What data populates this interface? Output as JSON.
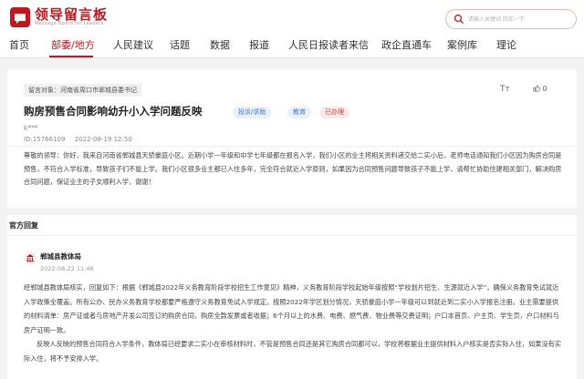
{
  "header": {
    "logo_title": "领导留言板",
    "logo_subtitle": "Message Board for Leaders",
    "search_placeholder": "请输入关键词 回车一下"
  },
  "nav": {
    "items": [
      "首页",
      "部委/地方",
      "人民建议",
      "话题",
      "数据",
      "报道",
      "人民日报读者来信",
      "政企直通车",
      "案例库",
      "理论"
    ],
    "active": "部委/地方"
  },
  "message": {
    "target": "留言对象：河南省周口市郸城县委书记",
    "font_icon": "Tт",
    "likes": "0",
    "title": "购房预售合同影响幼升小入学问题反映",
    "badges": [
      "投诉/求助",
      "教育",
      "已办理"
    ],
    "author": "k***",
    "id": "ID:15766109",
    "time": "2022-08-19 12:50",
    "body": "尊敬的领导：你好，我来自河南省郸城县天骄豪庭小区。近期小学一年级和中学七年级都在报名入学，我们小区的业主将相关资料递交给二实小后，老师电话通知我们小区因为购房合同是预售，不符合入学标准，导致孩子们不能上学。我们小区很多业主都已入住多年，完全符合就近入学原则，如果因为合同预售问题导致孩子不能上学，请帮忙协助住建相关部门，解决购房合同问题，保证业主的子女顺利入学，谢谢！"
  },
  "reply": {
    "heading": "官方回复",
    "org": "郸城县教体局",
    "time": "2022-08-22 11:46",
    "body_p1": "经郸城县教体局核实，回复如下：根据《郸城县2022年义务教育阶段学校招生工作意见》精神，义务教育阶段学校起始年级按照“学校划片招生、生源就近入学”，确保义务教育免试就近入学政策全覆盖。所有公办、民办义务教育学校都要严格遵守义务教育免试入学规定。按照2022年学区划分情况，天骄豪庭小学一年级可以到就近到二实小入学报名注册。业主需要提供的材料清单：房产证或者与房地产开发公司签订的购房合同，购房全款发票或者收据；6个月以上的水费、电费、燃气费、物业费等交费证明；户口本首页、户主页、学生页，户口材料与房产证明一致。",
    "body_p2": "反映人反映的预售合同符合入学条件，教体局已经要求二实小在审核材料时，不管是预售合同还是其它购房合同都可以，学校将根据业主提供材料入户核实是否实际入住，如果没有实际入住，将不予安排入学。"
  },
  "colors": {
    "brand_red": "#c8151d",
    "badge_blue": "#3f7ad1",
    "badge_red": "#d8362f"
  }
}
